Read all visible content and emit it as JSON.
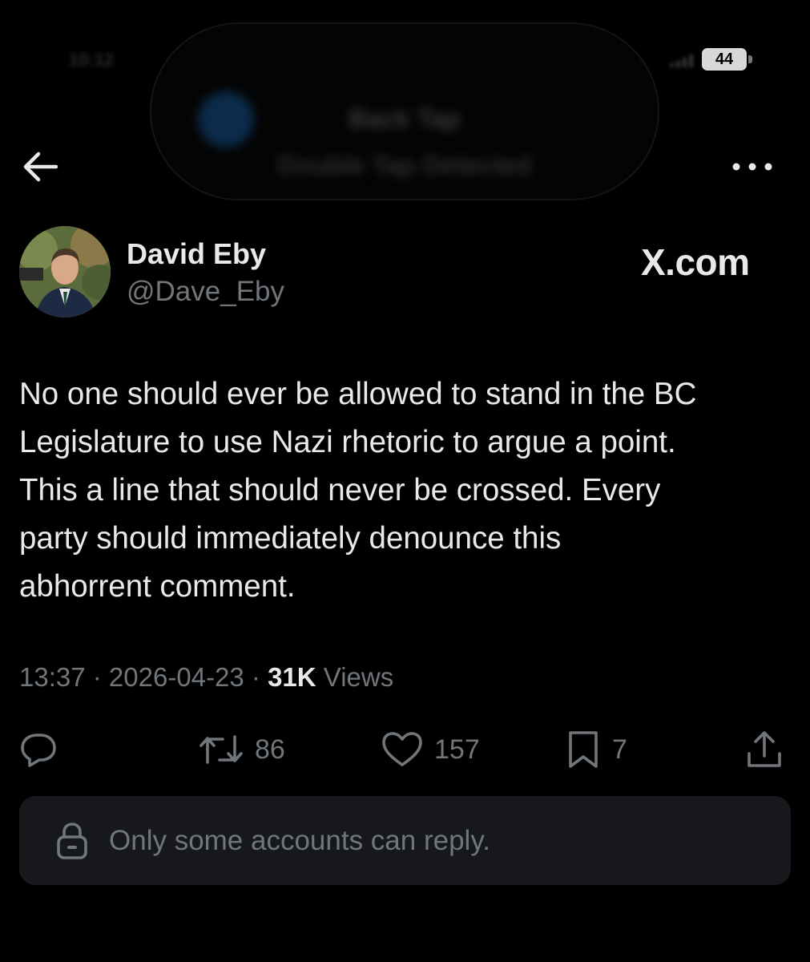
{
  "status_bar": {
    "time": "10:12",
    "battery": "44"
  },
  "notification": {
    "title": "Back Tap",
    "subtitle": "Double Tap Detected"
  },
  "header": {
    "back_icon": "arrow-left-icon",
    "more_icon": "more-horizontal-icon"
  },
  "author": {
    "name": "David Eby",
    "handle": "@Dave_Eby"
  },
  "watermark": "X.com",
  "tweet": {
    "text": "No one should ever be allowed to stand in the BC\nLegislature to use Nazi rhetoric to argue a point.\nThis a line that should never be crossed. Every\nparty should immediately denounce this\nabhorrent comment.",
    "time": "13:37",
    "date": "2026-04-23",
    "views_count": "31K",
    "views_label": "Views",
    "separator": " · "
  },
  "actions": {
    "reply": {
      "icon": "reply-bubble-icon"
    },
    "retweet": {
      "icon": "retweet-icon",
      "count": "86"
    },
    "like": {
      "icon": "heart-icon",
      "count": "157"
    },
    "bookmark": {
      "icon": "bookmark-icon",
      "count": "7"
    },
    "share": {
      "icon": "share-icon"
    }
  },
  "reply_restriction": {
    "icon": "lock-icon",
    "text": "Only some accounts can reply."
  },
  "colors": {
    "background": "#000000",
    "primary_text": "#e7e9ea",
    "secondary_text": "#71767b",
    "reply_box": "#16181c"
  }
}
